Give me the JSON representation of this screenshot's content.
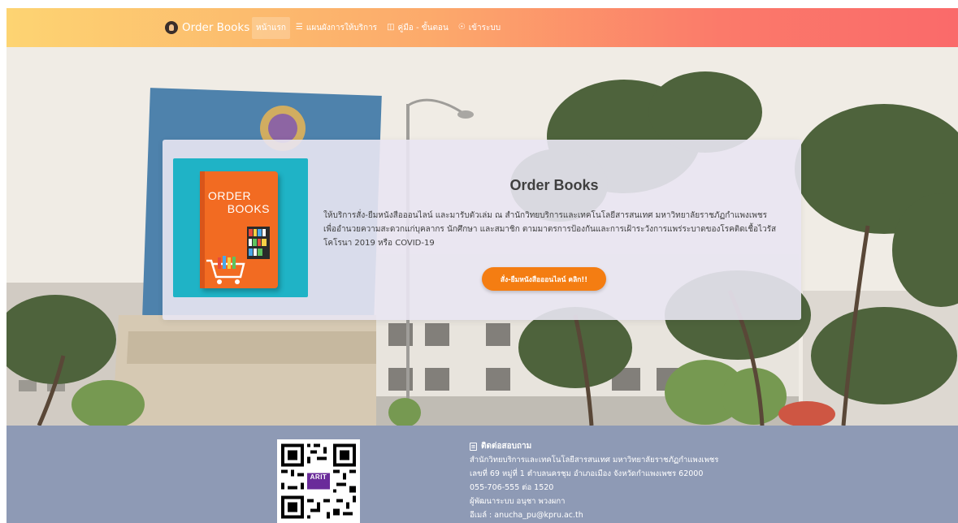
{
  "navbar": {
    "brand": "Order Books",
    "items": [
      {
        "label": "หน้าแรก",
        "icon": "",
        "active": true
      },
      {
        "label": "แผนผังการให้บริการ",
        "icon": "layers-icon",
        "active": false
      },
      {
        "label": "คู่มือ - ขั้นตอน",
        "icon": "book-open-icon",
        "active": false
      },
      {
        "label": "เข้าระบบ",
        "icon": "user-circle-icon",
        "active": false
      }
    ]
  },
  "hero": {
    "card": {
      "book_title_line1": "ORDER",
      "book_title_line2": "BOOKS",
      "title": "Order Books",
      "description": "ให้บริการสั่ง-ยืมหนังสือออนไลน์ และมารับตัวเล่ม ณ สำนักวิทยบริการและเทคโนโลยีสารสนเทศ มหาวิทยาลัยราชภัฏกำแพงเพชร เพื่ออำนวยความสะดวกแก่บุคลากร นักศึกษา และสมาชิก ตามมาตรการป้องกันและการเฝ้าระวังการแพร่ระบาดของโรคติดเชื้อไวรัสโคโรนา 2019 หรือ COVID-19",
      "cta_label": "สั่ง-ยืมหนังสือออนไลน์ คลิก!!"
    }
  },
  "footer": {
    "contact_title": "ติดต่อสอบถาม",
    "lines": [
      "สำนักวิทยบริการและเทคโนโลยีสารสนเทศ มหาวิทยาลัยราชภัฏกำแพงเพชร",
      "เลขที่ 69 หมู่ที่ 1 ตำบลนครชุม อำเภอเมือง จังหวัดกำแพงเพชร 62000",
      "055-706-555 ต่อ 1520",
      "ผู้พัฒนาระบบ อนุชา พวงผกา",
      "อีเมล์ : anucha_pu@kpru.ac.th"
    ],
    "qr_badge": "ARIT"
  },
  "colors": {
    "nav_gradient_start": "#fdd472",
    "nav_gradient_end": "#fa6a6a",
    "cta": "#f47d12",
    "footer_bg": "#8e9ab5",
    "card_image_bg": "#1fb3c6",
    "book_cover": "#f26b22"
  }
}
